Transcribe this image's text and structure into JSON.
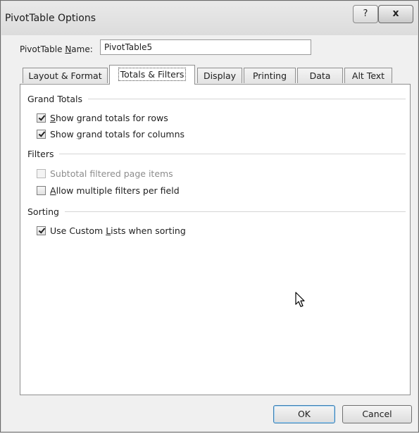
{
  "window": {
    "title": "PivotTable Options",
    "help_glyph": "?",
    "close_glyph": "x"
  },
  "name_field": {
    "label_pre": "PivotTable ",
    "label_ul": "N",
    "label_post": "ame:",
    "value": "PivotTable5"
  },
  "tabs": [
    {
      "label": "Layout & Format",
      "active": false
    },
    {
      "label": "Totals & Filters",
      "active": true
    },
    {
      "label": "Display",
      "active": false
    },
    {
      "label": "Printing",
      "active": false
    },
    {
      "label": "Data",
      "active": false
    },
    {
      "label": "Alt Text",
      "active": false
    }
  ],
  "sections": {
    "grand_totals": {
      "title": "Grand Totals",
      "rows": {
        "pre": "",
        "ul": "S",
        "post": "how grand totals for rows",
        "checked": true
      },
      "columns": {
        "pre": "Show ",
        "ul": "g",
        "post": "rand totals for columns",
        "checked": true
      }
    },
    "filters": {
      "title": "Filters",
      "subtotal": {
        "text": "Subtotal filtered page items",
        "checked": false,
        "enabled": false
      },
      "multiple": {
        "pre": "",
        "ul": "A",
        "post": "llow multiple filters per field",
        "checked": false
      }
    },
    "sorting": {
      "title": "Sorting",
      "custom_lists": {
        "pre": "Use Custom ",
        "ul": "L",
        "post": "ists when sorting",
        "checked": true
      }
    }
  },
  "buttons": {
    "ok": "OK",
    "cancel": "Cancel"
  }
}
